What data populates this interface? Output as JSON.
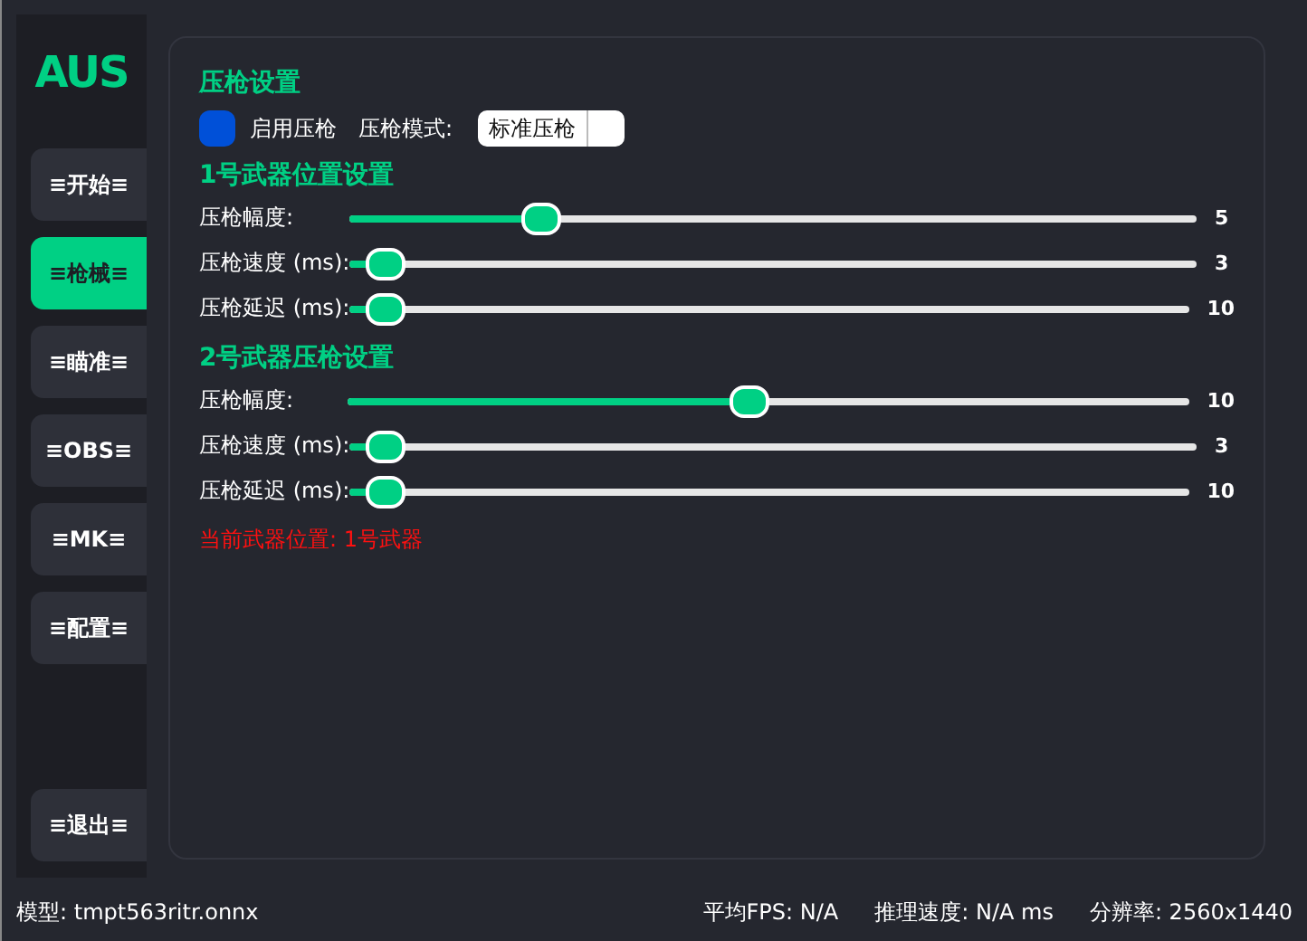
{
  "logo": "AUS",
  "nav": [
    {
      "label": "≡开始≡",
      "selected": false
    },
    {
      "label": "≡枪械≡",
      "selected": true
    },
    {
      "label": "≡瞄准≡",
      "selected": false
    },
    {
      "label": "≡OBS≡",
      "selected": false
    },
    {
      "label": "≡MK≡",
      "selected": false
    },
    {
      "label": "≡配置≡",
      "selected": false
    }
  ],
  "exit": "≡退出≡",
  "title": "压枪设置",
  "enable": {
    "label": "启用压枪",
    "checked": true
  },
  "mode": {
    "label": "压枪模式:",
    "value": "标准压枪"
  },
  "groups": [
    {
      "title": "1号武器位置设置",
      "sliders": [
        {
          "label": "压枪幅度:",
          "level": 0.224,
          "reading": "5"
        },
        {
          "label": "压枪速度 (ms):",
          "level": 0.04,
          "reading": "3"
        },
        {
          "label": "压枪延迟 (ms):",
          "level": 0.04,
          "reading": "10"
        }
      ]
    },
    {
      "title": "2号武器压枪设置",
      "sliders": [
        {
          "label": "压枪幅度:",
          "level": 0.476,
          "reading": "10"
        },
        {
          "label": "压枪速度 (ms):",
          "level": 0.04,
          "reading": "3"
        },
        {
          "label": "压枪延迟 (ms):",
          "level": 0.04,
          "reading": "10"
        }
      ]
    }
  ],
  "current": "当前武器位置: 1号武器",
  "status": {
    "model": "模型: tmpt563ritr.onnx",
    "fps": "平均FPS: N/A",
    "speed": "推理速度: N/A ms",
    "resolution": "分辨率: 2560x1440"
  }
}
